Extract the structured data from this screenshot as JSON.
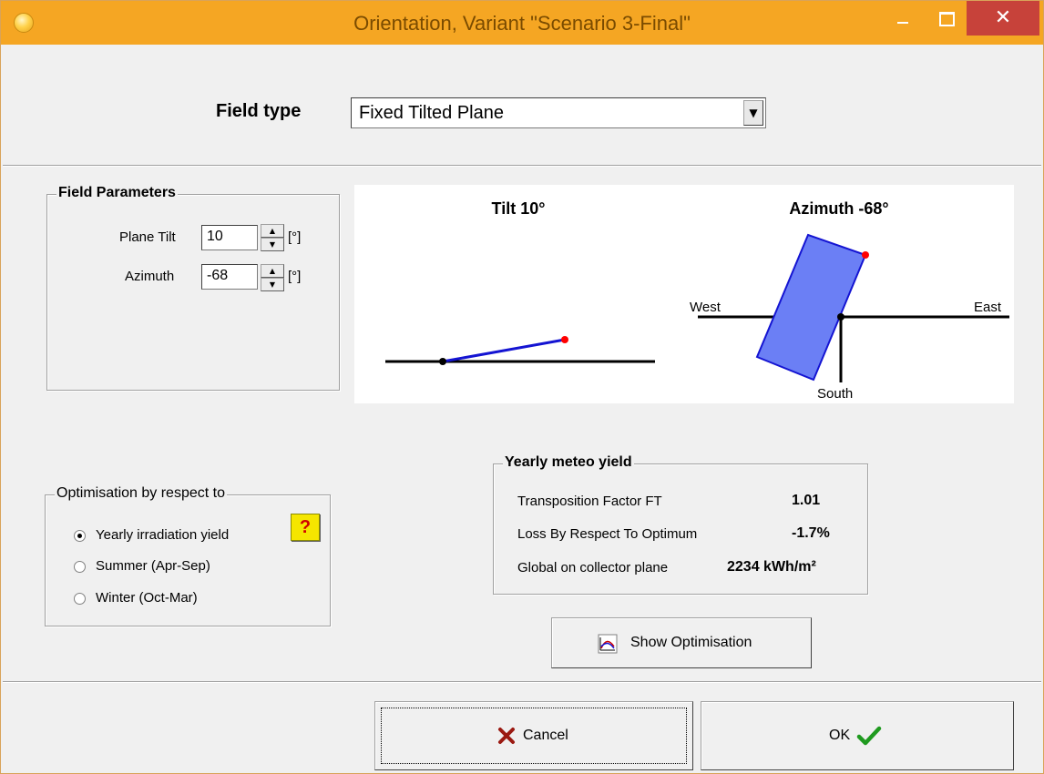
{
  "window": {
    "title": "Orientation, Variant \"Scenario 3-Final\"",
    "controls": {
      "close_glyph": "✕"
    }
  },
  "field_type": {
    "label": "Field type",
    "selected": "Fixed Tilted Plane",
    "dropdown_glyph": "▼"
  },
  "field_parameters": {
    "title": "Field Parameters",
    "plane_tilt": {
      "label": "Plane Tilt",
      "value": "10",
      "unit": "[°]"
    },
    "azimuth": {
      "label": "Azimuth",
      "value": "-68",
      "unit": "[°]"
    }
  },
  "diagram": {
    "tilt_title": "Tilt 10°",
    "azimuth_title": "Azimuth -68°",
    "west": "West",
    "east": "East",
    "south": "South",
    "plane_color": "#6b7ff5",
    "edge_color": "#1414d2",
    "marker_color": "#ff0000"
  },
  "optimisation": {
    "title": "Optimisation by respect to",
    "options": [
      {
        "label": "Yearly irradiation yield",
        "checked": true
      },
      {
        "label": "Summer (Apr-Sep)",
        "checked": false
      },
      {
        "label": "Winter (Oct-Mar)",
        "checked": false
      }
    ],
    "help_label": "?"
  },
  "yearly_meteo": {
    "title": "Yearly meteo yield",
    "rows": [
      {
        "label": "Transposition Factor FT",
        "value": "1.01"
      },
      {
        "label": "Loss By Respect To Optimum",
        "value": "-1.7%"
      },
      {
        "label": "Global on collector plane",
        "value": "2234 kWh/m²"
      }
    ]
  },
  "buttons": {
    "show_optimisation": "Show Optimisation",
    "cancel": "Cancel",
    "ok": "OK"
  },
  "colors": {
    "titlebar": "#f5a623",
    "close_button": "#c7423a",
    "dialog_bg": "#f0f0f0"
  }
}
